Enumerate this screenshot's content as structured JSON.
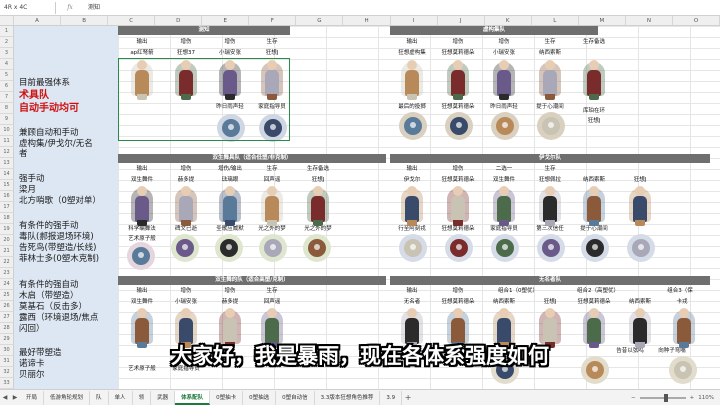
{
  "formula_bar": {
    "name_box": "4R x 4C",
    "fx": "fx",
    "value": "测知"
  },
  "columns": [
    "A",
    "B",
    "C",
    "D",
    "E",
    "F",
    "G",
    "H",
    "I",
    "J",
    "K",
    "L",
    "M",
    "N",
    "O"
  ],
  "rows": [
    "1",
    "2",
    "3",
    "4",
    "5",
    "6",
    "7",
    "8",
    "9",
    "10",
    "11",
    "12",
    "13",
    "14",
    "15",
    "16",
    "17",
    "18",
    "19",
    "20",
    "21",
    "22",
    "23",
    "24",
    "25",
    "26",
    "27",
    "28",
    "29",
    "30",
    "31",
    "32",
    "33"
  ],
  "left_panel": [
    {
      "text": "目前最强体系",
      "style": "normal"
    },
    {
      "text": "术具队",
      "style": "red"
    },
    {
      "text": "自动手动均可",
      "style": "red"
    },
    {
      "text": "兼顾自动和手动",
      "style": "normal"
    },
    {
      "text": "虚构集/伊戈尔/无名",
      "style": "normal"
    },
    {
      "text": "者",
      "style": "normal"
    },
    {
      "text": "强手动",
      "style": "normal"
    },
    {
      "text": "梁月",
      "style": "normal"
    },
    {
      "text": "北方哨歌（0塑对单）",
      "style": "normal"
    },
    {
      "text": "有条件的强手动",
      "style": "normal"
    },
    {
      "text": "毒队(郝报退场环境)",
      "style": "normal"
    },
    {
      "text": "告死鸟(带塑造/长线)",
      "style": "normal"
    },
    {
      "text": "菲林士多(0塑木克制)",
      "style": "normal"
    },
    {
      "text": "有条件的强自动",
      "style": "normal"
    },
    {
      "text": "木启（带塑造）",
      "style": "normal"
    },
    {
      "text": "莫基石（反击多）",
      "style": "normal"
    },
    {
      "text": "露西（环境退场/焦点",
      "style": "normal"
    },
    {
      "text": "闪回）",
      "style": "normal"
    },
    {
      "text": "最好带塑造",
      "style": "normal"
    },
    {
      "text": "诺谛卡",
      "style": "normal"
    },
    {
      "text": "贝丽尔",
      "style": "normal"
    }
  ],
  "groups": [
    {
      "title": "测知"
    },
    {
      "title": "虚构集队"
    },
    {
      "title": "双生舞具队（适合低塑/非克制）"
    },
    {
      "title": "伊戈尔队"
    },
    {
      "title": "双生舞的队（适合高塑/克制）"
    },
    {
      "title": "无名者队"
    }
  ],
  "sub_labels": {
    "a1": [
      "输出",
      "增伤",
      "增伤",
      "生存"
    ],
    "a2": [
      "ap红弩箭",
      "狂想37",
      "小瑞安张",
      "狂想J"
    ],
    "a3": [
      "昨日雨声轻",
      "家庭指导员"
    ],
    "b1": [
      "输出",
      "增伤",
      "增伤",
      "生存",
      "生存备选"
    ],
    "b2": [
      "狂想虚构集",
      "狂想莫莉德朵",
      "小瑞安张",
      "纳西索斯",
      "库珀在环",
      "狂想J"
    ],
    "b3": [
      "最后的投掷",
      "狂想莫莉德朵",
      "昨日雨声轻",
      "提于心潮间"
    ],
    "c1": [
      "输出",
      "增伤",
      "增伤/输出",
      "生存",
      "生存备选"
    ],
    "c2": [
      "双生舞件",
      "赫多提",
      "琺璃眼",
      "回声谣",
      "狂想J"
    ],
    "c3": [
      "科学编舞法",
      "碑文已逝",
      "圣歌应威默",
      "光之外的梦",
      "光之外的梦"
    ],
    "c4": [
      "艺术原子般"
    ],
    "d1": [
      "输出",
      "增伤",
      "二选一",
      "生存"
    ],
    "d2": [
      "伊戈尔",
      "狂想莫莉德朵",
      "双生舞件",
      "狂想佩拉",
      "纳西索斯",
      "狂想J"
    ],
    "d3": [
      "行至阿刻戎",
      "狂想莫莉德朵",
      "家庭指导员",
      "第三次信任",
      "提于心潮间"
    ],
    "e1": [
      "输出",
      "增伤",
      "增伤",
      "生存"
    ],
    "e2": [
      "双生舞件",
      "小瑞安张",
      "赫多提",
      "回声谣"
    ],
    "e3": [
      "艺术原子般",
      "家庭指导员"
    ],
    "f1": [
      "输出",
      "增伤",
      "组合1（0塑优）",
      "组合2（高塑优）",
      "组合3（保"
    ],
    "f2": [
      "无名者",
      "狂想莫莉德朵",
      "纳西索斯",
      "狂想J",
      "狂想莫莉德朵",
      "纳西索斯",
      "卡戎"
    ],
    "f3": [
      "狂想莫莉德朵",
      "告昔以弦鸣",
      "向种子弯嘴"
    ]
  },
  "subtitle": "大家好，我是暴雨，现在各体系强度如何",
  "tabs": [
    "开局",
    "低游角轮规划",
    "队",
    "单人",
    "领",
    "武器",
    "体系配队",
    "0塑抽卡",
    "0塑抽选",
    "0塑自动信",
    "3.3版本狂想角色推荐",
    "3.9"
  ],
  "active_tab": "体系配队",
  "status": {
    "zoom": "110%",
    "plus": "+",
    "minus": "−"
  },
  "colors": {
    "accent_green": "#1f7a3a",
    "group_bar": "#6f6f6f",
    "left_panel": "#dde7f3",
    "red_text": "#d01010"
  }
}
